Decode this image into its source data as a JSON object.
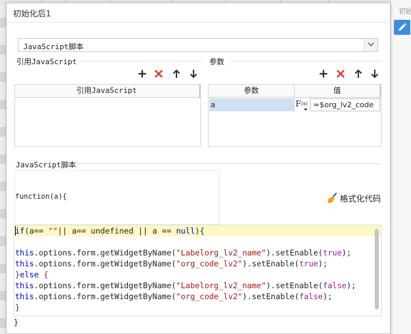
{
  "side_panel": {
    "label": "初始",
    "edit_icon": "pencil-icon"
  },
  "dialog": {
    "title": "初始化后1",
    "type_select": {
      "value": "JavaScript脚本",
      "arrow_icon": "chevron-down-icon"
    },
    "ref_section": {
      "label": "引用JavaScript",
      "toolbar": [
        "plus-icon",
        "close-icon",
        "arrow-up-icon",
        "arrow-down-icon"
      ],
      "column": "引用JavaScript"
    },
    "param_section": {
      "label": "参数",
      "toolbar": [
        "plus-icon",
        "close-icon",
        "arrow-up-icon",
        "arrow-down-icon"
      ],
      "columns": [
        "参数",
        "值"
      ],
      "rows": [
        {
          "name": "a",
          "fx_label": "F",
          "fx_sub": "(x)",
          "value": "=$org_lv2_code"
        }
      ]
    },
    "script_section": {
      "label": "JavaScript脚本",
      "signature": "function(a){",
      "format_button": "格式化代码",
      "code": {
        "line1_a": "if",
        "line1_b": "(a== ",
        "line1_c": "\"\"",
        "line1_d": "|| a== undefined || a == ",
        "line1_e": "null",
        "line1_f": "){",
        "line3_this": "this",
        "line3_mid": ".options.form.getWidgetByName(",
        "line3_str": "\"Labelorg_lv2_name\"",
        "line3_tail": ").setEnable(",
        "line3_bool": "true",
        "line3_end": ");",
        "line4_this": "this",
        "line4_mid": ".options.form.getWidgetByName(",
        "line4_str": "\"org_code_lv2\"",
        "line4_tail": ").setEnable(",
        "line4_bool": "true",
        "line4_end": ");",
        "line5_a": "}",
        "line5_b": "else",
        "line5_c": " {",
        "line6_this": "this",
        "line6_mid": ".options.form.getWidgetByName(",
        "line6_str": "\"Labelorg_lv2_name\"",
        "line6_tail": ").setEnable(",
        "line6_bool": "false",
        "line6_end": ");",
        "line7_this": "this",
        "line7_mid": ".options.form.getWidgetByName(",
        "line7_str": "\"org_code_lv2\"",
        "line7_tail": ").setEnable(",
        "line7_bool": "false",
        "line7_end": ");",
        "line8": "}"
      },
      "closing": "}"
    }
  }
}
